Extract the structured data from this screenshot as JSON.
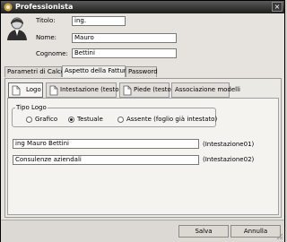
{
  "window": {
    "title": "Professionista",
    "close_glyph": "×"
  },
  "profile": {
    "titolo_label": "Titolo:",
    "titolo_value": "ing.",
    "nome_label": "Nome:",
    "nome_value": "Mauro",
    "cognome_label": "Cognome:",
    "cognome_value": "Bettini"
  },
  "tabs": [
    {
      "label": "Parametri di Calcolo",
      "active": false
    },
    {
      "label": "Aspetto della Fattura",
      "active": true
    },
    {
      "label": "Password",
      "active": false
    }
  ],
  "subtabs": [
    {
      "label": "Logo",
      "active": true,
      "icon": "document-icon"
    },
    {
      "label": "Intestazione (testo)",
      "active": false,
      "icon": "document-icon"
    },
    {
      "label": "Piede (testo)",
      "active": false,
      "icon": "document-icon"
    },
    {
      "label": "Associazione modelli",
      "active": false
    }
  ],
  "logo_type": {
    "legend": "Tipo Logo",
    "options": [
      {
        "label": "Grafico",
        "checked": false
      },
      {
        "label": "Testuale",
        "checked": true
      },
      {
        "label": "Assente (foglio già intestato)",
        "checked": false
      }
    ]
  },
  "header_lines": [
    {
      "value": "ing Mauro Bettini",
      "tag": "(Intestazione01)"
    },
    {
      "value": "Consulenze aziendali",
      "tag": "(Intestazione02)"
    }
  ],
  "footer": {
    "save_label": "Salva",
    "cancel_label": "Annulla"
  },
  "colors": {
    "titlebar": "#2b2b2b",
    "window_bg": "#e6e3de"
  }
}
